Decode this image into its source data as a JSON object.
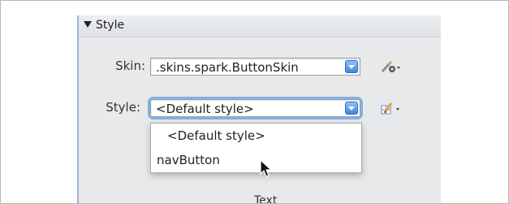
{
  "section": {
    "title": "Style"
  },
  "skin": {
    "label": "Skin:",
    "value": ".skins.spark.ButtonSkin"
  },
  "style": {
    "label": "Style:",
    "value": "<Default style>"
  },
  "dropdown": {
    "items": [
      "<Default style>",
      "navButton"
    ]
  },
  "next_section": {
    "title": "Text"
  },
  "icons": {
    "skin_tool": "brush-gear-icon",
    "style_tool": "pencil-grid-icon"
  },
  "colors": {
    "accent": "#3f86e0",
    "focus": "#7fb0ea",
    "panel": "#e8e9ea"
  }
}
